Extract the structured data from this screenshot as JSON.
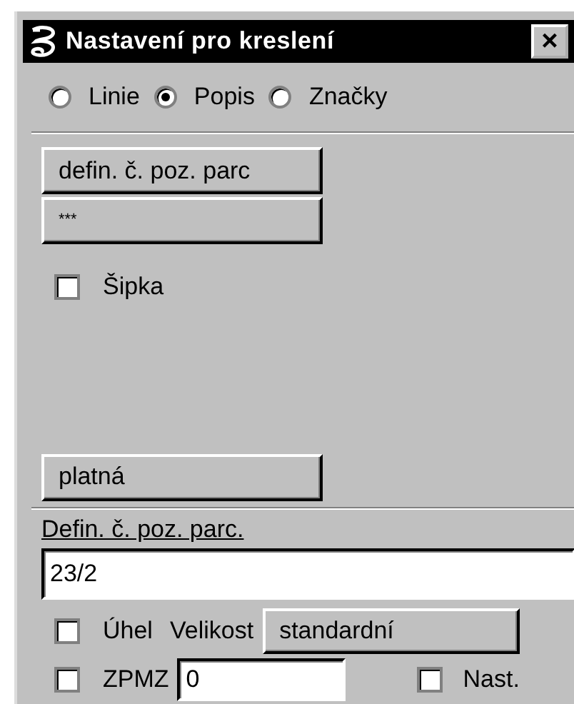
{
  "window": {
    "title": "Nastavení pro kreslení",
    "close": "×"
  },
  "modes": [
    {
      "label": "Linie",
      "selected": false
    },
    {
      "label": "Popis",
      "selected": true
    },
    {
      "label": "Značky",
      "selected": false
    }
  ],
  "buttons": [
    {
      "label": "defin. č. poz. parc"
    },
    {
      "label": "***"
    }
  ],
  "arrow": {
    "label": "Šipka",
    "checked": false
  },
  "validity_button": {
    "label": "platná"
  },
  "definition": {
    "label": "Defin. č. poz. parc.",
    "value": "23/2"
  },
  "angle": {
    "label": "Úhel",
    "checked": false
  },
  "size": {
    "label": "Velikost",
    "value": "standardní"
  },
  "zpmz": {
    "label": "ZPMZ",
    "checked": false,
    "value": "0"
  },
  "nast": {
    "label": "Nast.",
    "checked": false
  }
}
